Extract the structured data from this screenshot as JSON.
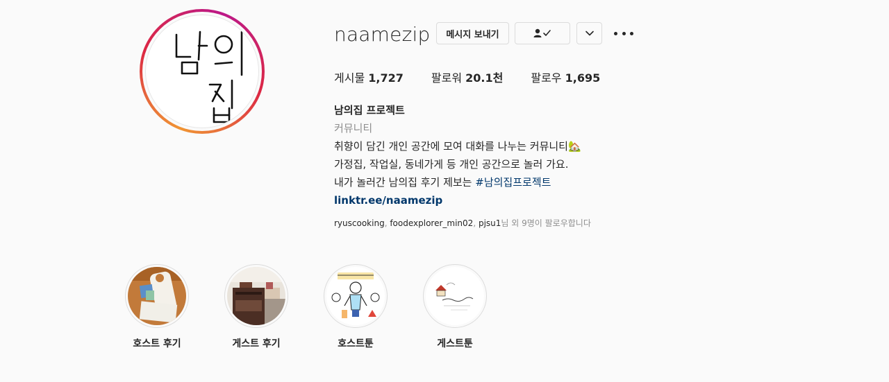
{
  "profile": {
    "username": "naamezip",
    "avatar_logo_text": "남의집",
    "buttons": {
      "message_label": "메시지 보내기",
      "following_icon": "person-check-icon",
      "dropdown_icon": "chevron-down-icon",
      "more_icon": "more-options-icon"
    },
    "stats": {
      "posts_label": "게시물",
      "posts_value": "1,727",
      "followers_label": "팔로워",
      "followers_value": "20.1천",
      "following_label": "팔로우",
      "following_value": "1,695"
    },
    "bio": {
      "name": "남의집 프로젝트",
      "category": "커뮤니티",
      "line1": "취향이 담긴 개인 공간에 모여 대화를 나누는 커뮤니티",
      "line1_emoji": "🏡",
      "line2": "가정집, 작업실, 동네가게 등 개인 공간으로 놀러 가요.",
      "line3_text": "내가 놀러간 남의집 후기 제보는 ",
      "line3_hashtag": "#남의집프로젝트",
      "link": "linktr.ee/naamezip"
    },
    "followed_by": {
      "users": [
        "ryuscooking",
        "foodexplorer_min02",
        "pjsu1"
      ],
      "separator": ", ",
      "suffix": "님 외 9명이 팔로우합니다"
    }
  },
  "highlights": [
    {
      "label": "호스트 후기"
    },
    {
      "label": "게스트 후기"
    },
    {
      "label": "호스트툰"
    },
    {
      "label": "게스트툰"
    }
  ],
  "colors": {
    "background": "#fafafa",
    "text": "#262626",
    "muted": "#8e8e8e",
    "link": "#00376b",
    "story_ring_start": "#f09433",
    "story_ring_end": "#bc1888"
  }
}
